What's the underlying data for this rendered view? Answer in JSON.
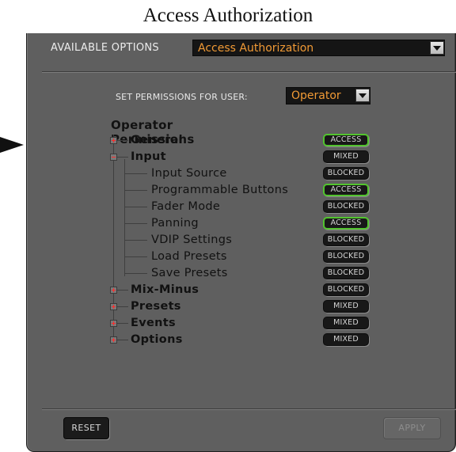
{
  "caption": "Access Authorization",
  "available_options": {
    "label": "AVAILABLE OPTIONS",
    "selected": "Access Authorization"
  },
  "permissions_user": {
    "label": "SET PERMISSIONS FOR USER:",
    "selected": "Operator"
  },
  "tree": {
    "title": "Operator Permissions",
    "rows": [
      {
        "label": "General",
        "level": 0,
        "expander": "plus",
        "status": "ACCESS"
      },
      {
        "label": "Input",
        "level": 0,
        "expander": "minus",
        "status": "MIXED"
      },
      {
        "label": "Input Source",
        "level": 1,
        "status": "BLOCKED"
      },
      {
        "label": "Programmable Buttons",
        "level": 1,
        "status": "ACCESS"
      },
      {
        "label": "Fader Mode",
        "level": 1,
        "status": "BLOCKED"
      },
      {
        "label": "Panning",
        "level": 1,
        "status": "ACCESS"
      },
      {
        "label": "VDIP Settings",
        "level": 1,
        "status": "BLOCKED"
      },
      {
        "label": "Load Presets",
        "level": 1,
        "status": "BLOCKED"
      },
      {
        "label": "Save Presets",
        "level": 1,
        "status": "BLOCKED"
      },
      {
        "label": "Mix-Minus",
        "level": 0,
        "expander": "plus",
        "status": "BLOCKED"
      },
      {
        "label": "Presets",
        "level": 0,
        "expander": "plus",
        "status": "MIXED"
      },
      {
        "label": "Events",
        "level": 0,
        "expander": "plus",
        "status": "MIXED"
      },
      {
        "label": "Options",
        "level": 0,
        "expander": "plus",
        "status": "MIXED"
      }
    ]
  },
  "buttons": {
    "reset": "RESET",
    "apply": "APPLY"
  },
  "colors": {
    "panel": "#5f5f5f",
    "select_text": "#f19a35",
    "access_border": "#52c42e",
    "expander_mark": "#ff2a2a"
  }
}
